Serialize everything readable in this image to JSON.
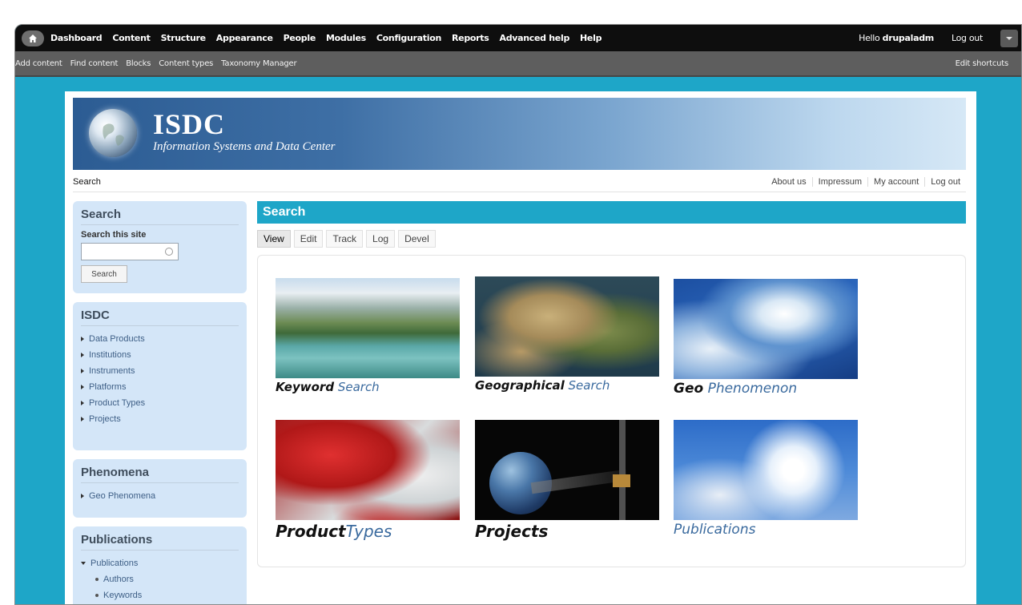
{
  "toolbar": {
    "menu": [
      "Dashboard",
      "Content",
      "Structure",
      "Appearance",
      "People",
      "Modules",
      "Configuration",
      "Reports",
      "Advanced help",
      "Help"
    ],
    "hello_prefix": "Hello ",
    "username": "drupaladm",
    "logout": "Log out",
    "shortcuts": [
      "Add content",
      "Find content",
      "Blocks",
      "Content types",
      "Taxonomy Manager"
    ],
    "edit_shortcuts": "Edit shortcuts"
  },
  "site": {
    "name": "ISDC",
    "slogan": "Information Systems and Data Center"
  },
  "secondary": {
    "breadcrumb": "Search",
    "links": [
      "About us",
      "Impressum",
      "My account",
      "Log out"
    ]
  },
  "sidebar": {
    "search": {
      "title": "Search",
      "label": "Search this site",
      "value": "",
      "button": "Search"
    },
    "isdc": {
      "title": "ISDC",
      "items": [
        "Data Products",
        "Institutions",
        "Instruments",
        "Platforms",
        "Product Types",
        "Projects"
      ]
    },
    "phenomena": {
      "title": "Phenomena",
      "items": [
        "Geo Phenomena"
      ]
    },
    "publications": {
      "title": "Publications",
      "items": [
        "Publications"
      ],
      "subitems": [
        "Authors",
        "Keywords"
      ]
    }
  },
  "main": {
    "title": "Search",
    "tabs": [
      "View",
      "Edit",
      "Track",
      "Log",
      "Devel"
    ],
    "tiles": [
      {
        "a": "Keyword",
        "b": " Search"
      },
      {
        "a": "Geographical",
        "b": " Search"
      },
      {
        "a": "Geo",
        "b": " Phenomenon"
      },
      {
        "a": "Product",
        "b": "Types"
      },
      {
        "a": "Projects",
        "b": ""
      },
      {
        "a": "",
        "b": "Publications"
      }
    ]
  }
}
